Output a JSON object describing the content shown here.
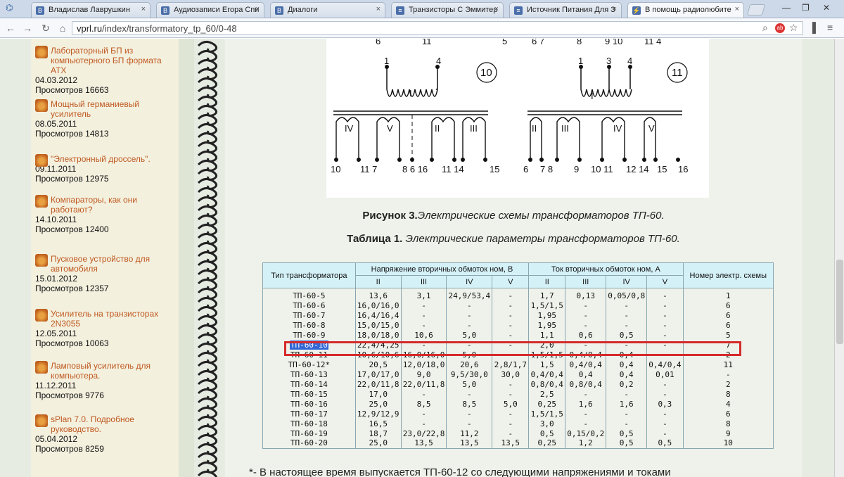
{
  "browser": {
    "tabs": [
      {
        "label": "Владислав Лаврушкин",
        "favicon": "vk-icon"
      },
      {
        "label": "Аудиозаписи Егора Спи",
        "favicon": "vk-icon"
      },
      {
        "label": "Диалоги",
        "favicon": "vk-icon"
      },
      {
        "label": "Транзисторы С Эммитер",
        "favicon": "page-icon"
      },
      {
        "label": "Источник Питания Для З",
        "favicon": "page-icon"
      },
      {
        "label": "В помощь радиолюбите",
        "favicon": "radio-icon"
      }
    ],
    "url_host": "vprl.ru",
    "url_path": "/index/transformatory_tp_60/0-48"
  },
  "sidebar": {
    "items": [
      {
        "title": "Лабораторный БП из компьютерного БП формата АТХ",
        "date": "04.03.2012",
        "views": "Просмотров 16663"
      },
      {
        "title": "Мощный германиевый усилитель",
        "date": "08.05.2011",
        "views": "Просмотров 14813"
      },
      {
        "title": "\"Электронный дроссель\".",
        "date": "09.11.2011",
        "views": "Просмотров 12975"
      },
      {
        "title": "Компараторы, как они работают?",
        "date": "14.10.2011",
        "views": "Просмотров 12400"
      },
      {
        "title": "Пусковое устройство для автомобиля",
        "date": "15.01.2012",
        "views": "Просмотров 12357"
      },
      {
        "title": "Усилитель на транзисторах 2N3055",
        "date": "12.05.2011",
        "views": "Просмотров 10063"
      },
      {
        "title": "Ламповый усилитель для компьютера.",
        "date": "11.12.2011",
        "views": "Просмотров 9776"
      },
      {
        "title": "sPlan 7.0. Подробное руководство.",
        "date": "05.04.2012",
        "views": "Просмотров 8259"
      }
    ]
  },
  "figure": {
    "caption_bold": "Рисунок 3.",
    "caption_italic": "Электрические схемы трансформаторов ТП-60.",
    "scheme_labels": [
      "10",
      "11"
    ]
  },
  "table": {
    "caption_bold": "Таблица 1.",
    "caption_italic": " Электрические параметры трансформаторов ТП-60.",
    "headers": {
      "type": "Тип трансформатора",
      "voltage": "Напряжение вторичных обмоток ном, В",
      "current": "Ток вторичных обмоток ном, А",
      "scheme": "Номер электр. схемы",
      "sub": [
        "II",
        "III",
        "IV",
        "V",
        "II",
        "III",
        "IV",
        "V"
      ]
    },
    "rows": [
      [
        "ТП-60-5",
        "13,6",
        "3,1",
        "24,9/53,4",
        "-",
        "1,7",
        "0,13",
        "0,05/0,8",
        "-",
        "1"
      ],
      [
        "ТП-60-6",
        "16,0/16,0",
        "-",
        "-",
        "-",
        "1,5/1,5",
        "-",
        "-",
        "-",
        "6"
      ],
      [
        "ТП-60-7",
        "16,4/16,4",
        "-",
        "-",
        "-",
        "1,95",
        "-",
        "-",
        "-",
        "6"
      ],
      [
        "ТП-60-8",
        "15,0/15,0",
        "-",
        "-",
        "-",
        "1,95",
        "-",
        "-",
        "-",
        "6"
      ],
      [
        "ТП-60-9",
        "18,0/18,0",
        "10,6",
        "5,0",
        "-",
        "1,1",
        "0,6",
        "0,5",
        "-",
        "5"
      ],
      [
        "ТП-60-10",
        "22,4/4,25",
        "-",
        "-",
        "-",
        "2,0",
        "-",
        "-",
        "-",
        "7"
      ],
      [
        "ТП-60-11",
        "10,6/10,6",
        "16,0/16,0",
        "5,0",
        "-",
        "1,5/1,5",
        "0,4/0,4",
        "0,4",
        "-",
        "2"
      ],
      [
        "ТП-60-12*",
        "20,5",
        "12,0/18,0",
        "20,6",
        "2,8/1,7",
        "1,5",
        "0,4/0,4",
        "0,4",
        "0,4/0,4",
        "11"
      ],
      [
        "ТП-60-13",
        "17,0/17,0",
        "9,0",
        "9,5/30,0",
        "30,0",
        "0,4/0,4",
        "0,4",
        "0,4",
        "0,01",
        "-"
      ],
      [
        "ТП-60-14",
        "22,0/11,8",
        "22,0/11,8",
        "5,0",
        "-",
        "0,8/0,4",
        "0,8/0,4",
        "0,2",
        "-",
        "2"
      ],
      [
        "ТП-60-15",
        "17,0",
        "-",
        "-",
        "-",
        "2,5",
        "-",
        "-",
        "-",
        "8"
      ],
      [
        "ТП-60-16",
        "25,0",
        "8,5",
        "8,5",
        "5,0",
        "0,25",
        "1,6",
        "1,6",
        "0,3",
        "4"
      ],
      [
        "ТП-60-17",
        "12,9/12,9",
        "-",
        "-",
        "-",
        "1,5/1,5",
        "-",
        "-",
        "-",
        "6"
      ],
      [
        "ТП-60-18",
        "16,5",
        "-",
        "-",
        "-",
        "3,0",
        "-",
        "-",
        "-",
        "8"
      ],
      [
        "ТП-60-19",
        "18,7",
        "23,0/22,8",
        "11,2",
        "-",
        "0,5",
        "0,15/0,2",
        "0,5",
        "-",
        "9"
      ],
      [
        "ТП-60-20",
        "25,0",
        "13,5",
        "13,5",
        "13,5",
        "0,25",
        "1,2",
        "0,5",
        "0,5",
        "10"
      ]
    ],
    "selected_row": 5
  },
  "footnote": "*- В настоящее время выпускается ТП-60-12 со следующими напряжениями и токами"
}
